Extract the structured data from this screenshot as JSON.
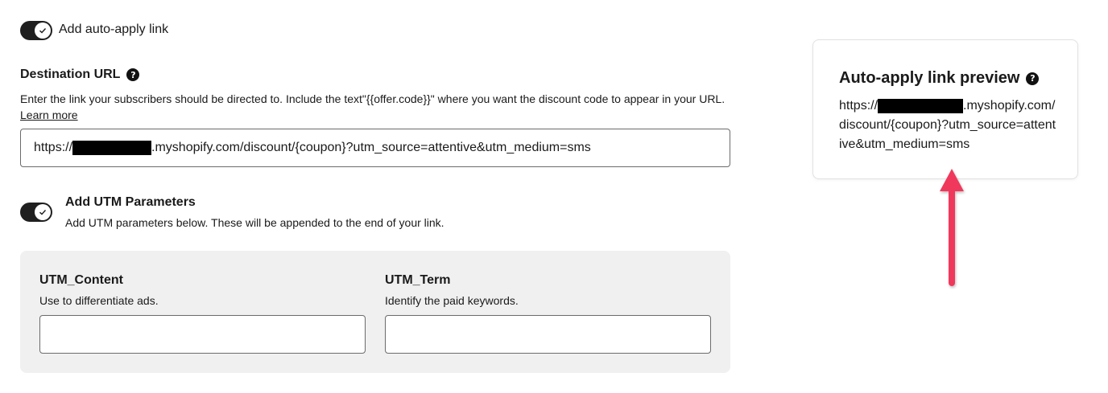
{
  "auto_apply": {
    "toggle_on": true,
    "label": "Add auto-apply link"
  },
  "destination": {
    "title": "Destination URL",
    "description": "Enter the link your subscribers should be directed to. Include the text\"{{offer.code}}\" where you want the discount code to appear in your URL.",
    "learn_more": "Learn more",
    "url_prefix": "https://",
    "url_suffix": ".myshopify.com/discount/{coupon}?utm_source=attentive&utm_medium=sms"
  },
  "utm": {
    "toggle_on": true,
    "title": "Add UTM Parameters",
    "description": "Add UTM parameters below. These will be appended to the end of your link.",
    "content": {
      "label": "UTM_Content",
      "help": "Use to differentiate ads.",
      "value": ""
    },
    "term": {
      "label": "UTM_Term",
      "help": "Identify the paid keywords.",
      "value": ""
    }
  },
  "preview": {
    "title": "Auto-apply link preview",
    "prefix": "https://",
    "suffix": ".myshopify.com/discount/{coupon}?utm_source=attentive&utm_medium=sms"
  },
  "colors": {
    "toggle": "#1f1f1f",
    "panel": "#eff0ef",
    "arrow": "#f0395b"
  },
  "icons": {
    "help": "question-circle-icon",
    "check": "check-icon",
    "annotation": "arrow-up-icon"
  }
}
